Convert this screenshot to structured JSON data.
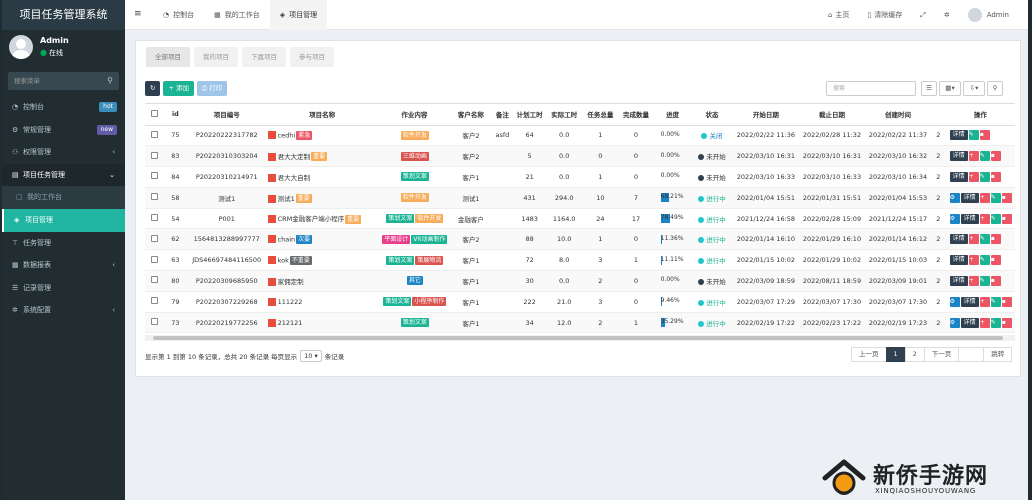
{
  "app": {
    "title": "项目任务管理系统"
  },
  "user": {
    "name": "Admin",
    "status": "在线"
  },
  "sidebar": {
    "search_placeholder": "搜索菜单",
    "items": [
      {
        "label": "控制台",
        "icon": "dashboard-icon",
        "badge": "hot"
      },
      {
        "label": "常规管理",
        "icon": "gear-icon",
        "badge": "new"
      },
      {
        "label": "权限管理",
        "icon": "group-icon",
        "caret": "‹"
      },
      {
        "label": "项目任务管理",
        "icon": "folder-icon",
        "caret": "⌄"
      },
      {
        "label": "我的工作台",
        "icon": "workbench-icon",
        "sub": true
      },
      {
        "label": "项目管理",
        "icon": "cube-icon",
        "active": true
      },
      {
        "label": "任务管理",
        "icon": "sitemap-icon"
      },
      {
        "label": "数据报表",
        "icon": "table-icon",
        "caret": "‹"
      },
      {
        "label": "记录管理",
        "icon": "list-icon"
      },
      {
        "label": "系统配置",
        "icon": "cogs-icon",
        "caret": "‹"
      }
    ]
  },
  "topnav": {
    "tabs": [
      {
        "label": "控制台",
        "icon": "dashboard-icon"
      },
      {
        "label": "我的工作台",
        "icon": "calendar-icon"
      },
      {
        "label": "项目管理",
        "icon": "cube-icon",
        "active": true
      }
    ],
    "right": {
      "home": "主页",
      "clear_cache": "清除缓存",
      "user": "Admin"
    }
  },
  "content_tabs": [
    "全部项目",
    "我的项目",
    "下属项目",
    "参与项目"
  ],
  "toolbar": {
    "add": "添加",
    "export": "打印",
    "search_placeholder": "搜索"
  },
  "table": {
    "headers": [
      "id",
      "项目编号",
      "项目名称",
      "作业内容",
      "客户名称",
      "备注",
      "计划工时",
      "实际工时",
      "任务总量",
      "完成数量",
      "进度",
      "状态",
      "开始日期",
      "截止日期",
      "创建时间",
      "",
      "操作"
    ],
    "rows": [
      {
        "id": "75",
        "code": "P20220222317782",
        "name": "cedhi",
        "name_tag": "紧急",
        "name_tag_color": "red",
        "work": [
          [
            "软件开发",
            "orange"
          ]
        ],
        "client": "客户2",
        "remark": "asfd",
        "plan": "64",
        "actual": "0.0",
        "total": "1",
        "done": "0",
        "progress": "0.00%",
        "progress_value": 0,
        "status": "关闭",
        "status_type": "close",
        "start": "2022/02/22 11:36",
        "end": "2022/02/28 11:32",
        "created": "2022/02/22 11:37",
        "cut": "2",
        "ops": [
          "详情"
        ],
        "has_cfg": false
      },
      {
        "id": "83",
        "code": "P20220310303204",
        "name": "君大大定制",
        "name_tag": "重要",
        "name_tag_color": "orange",
        "work": [
          [
            "三维动画",
            "red2"
          ]
        ],
        "client": "客户2",
        "remark": "",
        "plan": "5",
        "actual": "0.0",
        "total": "0",
        "done": "0",
        "progress": "0.00%",
        "progress_value": 0,
        "status": "未开始",
        "status_type": "notstart",
        "start": "2022/03/10 16:31",
        "end": "2022/03/10 16:31",
        "created": "2022/03/10 16:32",
        "cut": "2",
        "ops": [
          "详情"
        ],
        "has_cfg": false
      },
      {
        "id": "84",
        "code": "P20220310214971",
        "name": "君大大自制",
        "name_tag": "",
        "name_tag_color": "",
        "work": [
          [
            "策划文案",
            "green"
          ]
        ],
        "client": "客户1",
        "remark": "",
        "plan": "21",
        "actual": "0.0",
        "total": "1",
        "done": "0",
        "progress": "0.00%",
        "progress_value": 0,
        "status": "未开始",
        "status_type": "notstart",
        "start": "2022/03/10 16:33",
        "end": "2022/03/10 16:33",
        "created": "2022/03/10 16:34",
        "cut": "2",
        "ops": [
          "详情"
        ],
        "has_cfg": false
      },
      {
        "id": "58",
        "code": "测试1",
        "name": "测试1",
        "name_tag": "重要",
        "name_tag_color": "orange",
        "work": [
          [
            "软件开发",
            "orange"
          ]
        ],
        "client": "测试1",
        "remark": "",
        "plan": "431",
        "actual": "294.0",
        "total": "10",
        "done": "7",
        "progress": "68.21%",
        "progress_value": 68.21,
        "status": "进行中",
        "status_type": "progress",
        "start": "2022/01/04 15:51",
        "end": "2022/01/31 15:51",
        "created": "2022/01/04 15:53",
        "cut": "2",
        "ops": [
          "详情"
        ],
        "has_cfg": true
      },
      {
        "id": "54",
        "code": "P001",
        "name": "CRM金融客户端小程序",
        "name_tag": "重要",
        "name_tag_color": "orange",
        "work": [
          [
            "策划文案",
            "green"
          ],
          [
            "软件开发",
            "orange"
          ]
        ],
        "client": "金融客户",
        "remark": "",
        "plan": "1483",
        "actual": "1164.0",
        "total": "24",
        "done": "17",
        "progress": "78.49%",
        "progress_value": 78.49,
        "status": "进行中",
        "status_type": "progress",
        "start": "2021/12/24 16:58",
        "end": "2022/02/28 15:09",
        "created": "2021/12/24 15:17",
        "cut": "2",
        "ops": [
          "详情"
        ],
        "has_cfg": true
      },
      {
        "id": "62",
        "code": "1564813288997777",
        "name": "chain",
        "name_tag": "次要",
        "name_tag_color": "blue",
        "work": [
          [
            "平面设计",
            "pink"
          ],
          [
            "VR动画制作",
            "green"
          ]
        ],
        "client": "客户2",
        "remark": "",
        "plan": "88",
        "actual": "10.0",
        "total": "1",
        "done": "0",
        "progress": "11.36%",
        "progress_value": 11.36,
        "status": "进行中",
        "status_type": "progress",
        "start": "2022/01/14 16:10",
        "end": "2022/01/29 16:10",
        "created": "2022/01/14 16:12",
        "cut": "2",
        "ops": [
          "详情"
        ],
        "has_cfg": false
      },
      {
        "id": "63",
        "code": "JDS46697484116500",
        "name": "kok",
        "name_tag": "不重要",
        "name_tag_color": "gray",
        "work": [
          [
            "策划文案",
            "green"
          ],
          [
            "策展物流",
            "red2"
          ]
        ],
        "client": "客户1",
        "remark": "",
        "plan": "72",
        "actual": "8.0",
        "total": "3",
        "done": "1",
        "progress": "11.11%",
        "progress_value": 11.11,
        "status": "进行中",
        "status_type": "progress",
        "start": "2022/01/15 10:02",
        "end": "2022/01/29 10:02",
        "created": "2022/01/15 10:03",
        "cut": "2",
        "ops": [
          "详情"
        ],
        "has_cfg": false
      },
      {
        "id": "80",
        "code": "P20220309685950",
        "name": "家佣定制",
        "name_tag": "",
        "name_tag_color": "",
        "work": [
          [
            "其它",
            "blue"
          ]
        ],
        "client": "客户1",
        "remark": "",
        "plan": "30",
        "actual": "0.0",
        "total": "2",
        "done": "0",
        "progress": "0.00%",
        "progress_value": 0,
        "status": "未开始",
        "status_type": "notstart",
        "start": "2022/03/09 18:59",
        "end": "2022/08/11 18:59",
        "created": "2022/03/09 19:01",
        "cut": "2",
        "ops": [
          "详情"
        ],
        "has_cfg": false
      },
      {
        "id": "79",
        "code": "P20220307229268",
        "name": "111222",
        "name_tag": "",
        "name_tag_color": "",
        "work": [
          [
            "策划文案",
            "green"
          ],
          [
            "小程序制作",
            "red2"
          ]
        ],
        "client": "客户1",
        "remark": "",
        "plan": "222",
        "actual": "21.0",
        "total": "3",
        "done": "0",
        "progress": "9.46%",
        "progress_value": 9.46,
        "status": "进行中",
        "status_type": "progress",
        "start": "2022/03/07 17:29",
        "end": "2022/03/07 17:30",
        "created": "2022/03/07 17:30",
        "cut": "2",
        "ops": [
          "详情"
        ],
        "has_cfg": true
      },
      {
        "id": "73",
        "code": "P20220219772256",
        "name": "212121",
        "name_tag": "",
        "name_tag_color": "",
        "work": [
          [
            "策划文案",
            "green"
          ]
        ],
        "client": "客户1",
        "remark": "",
        "plan": "34",
        "actual": "12.0",
        "total": "2",
        "done": "1",
        "progress": "35.29%",
        "progress_value": 35.29,
        "status": "进行中",
        "status_type": "progress",
        "start": "2022/02/19 17:22",
        "end": "2022/02/23 17:22",
        "created": "2022/02/19 17:23",
        "cut": "2",
        "ops": [
          "详情"
        ],
        "has_cfg": true
      }
    ]
  },
  "pagination": {
    "info_prefix": "显示第 1 到第 10 条记录，总共 20 条记录 每页显示",
    "page_size": "10",
    "info_suffix": "条记录",
    "prev": "上一页",
    "pages": [
      "1",
      "2"
    ],
    "next": "下一页",
    "jump": "跳转"
  },
  "watermark": {
    "title": "新侨手游网",
    "subtitle": "XINQIAOSHOUYOUWANG"
  },
  "colors": {
    "sidebar": "#222d32",
    "active_menu": "#1fb5a1",
    "primary": "#1c84c6",
    "success": "#1ab394",
    "danger": "#ed5565",
    "warning": "#f8ac59",
    "dark": "#2f4050"
  }
}
